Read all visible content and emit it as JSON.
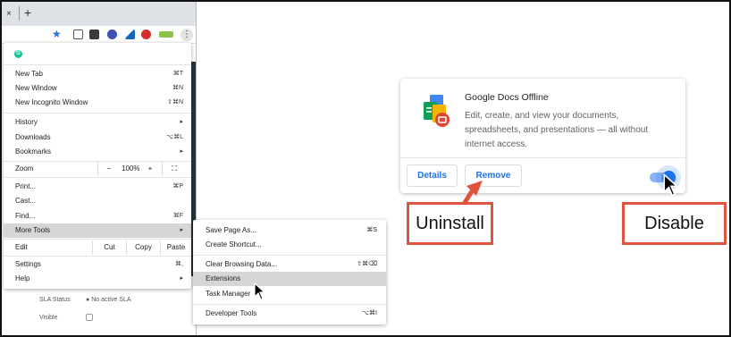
{
  "browser": {
    "tab_close": "×",
    "new_tab": "+",
    "kebab": "⋮"
  },
  "menu": {
    "items": [
      {
        "label": "New Tab",
        "shortcut": "⌘T"
      },
      {
        "label": "New Window",
        "shortcut": "⌘N"
      },
      {
        "label": "New Incognito Window",
        "shortcut": "⇧⌘N"
      },
      {
        "label": "History",
        "shortcut": "▸"
      },
      {
        "label": "Downloads",
        "shortcut": "⌥⌘L"
      },
      {
        "label": "Bookmarks",
        "shortcut": "▸"
      },
      {
        "label": "Print...",
        "shortcut": "⌘P"
      },
      {
        "label": "Cast...",
        "shortcut": ""
      },
      {
        "label": "Find...",
        "shortcut": "⌘F"
      },
      {
        "label": "More Tools",
        "shortcut": "▸"
      },
      {
        "label": "Settings",
        "shortcut": "⌘,"
      },
      {
        "label": "Help",
        "shortcut": "▸"
      }
    ],
    "zoom": {
      "label": "Zoom",
      "minus": "−",
      "value": "100%",
      "plus": "+",
      "fullscreen": "⛶"
    },
    "edit": {
      "label": "Edit",
      "cut": "Cut",
      "copy": "Copy",
      "paste": "Paste"
    }
  },
  "submenu": {
    "items": [
      {
        "label": "Save Page As...",
        "shortcut": "⌘S"
      },
      {
        "label": "Create Shortcut...",
        "shortcut": ""
      },
      {
        "label": "Clear Browsing Data...",
        "shortcut": "⇧⌘⌫"
      },
      {
        "label": "Extensions",
        "shortcut": ""
      },
      {
        "label": "Task Manager",
        "shortcut": ""
      },
      {
        "label": "Developer Tools",
        "shortcut": "⌥⌘I"
      }
    ]
  },
  "background_page": {
    "sla_label": "SLA Status",
    "sla_value": "No active SLA",
    "visible_label": "Visible"
  },
  "extension": {
    "name": "Google Docs Offline",
    "description": "Edit, create, and view your documents, spreadsheets, and presentations — all without internet access.",
    "details_label": "Details",
    "remove_label": "Remove",
    "enabled": true
  },
  "callouts": {
    "uninstall": "Uninstall",
    "disable": "Disable"
  },
  "colors": {
    "accent": "#1a73e8",
    "callout_border": "#e0533f",
    "menu_highlight": "#d6d6d6"
  }
}
